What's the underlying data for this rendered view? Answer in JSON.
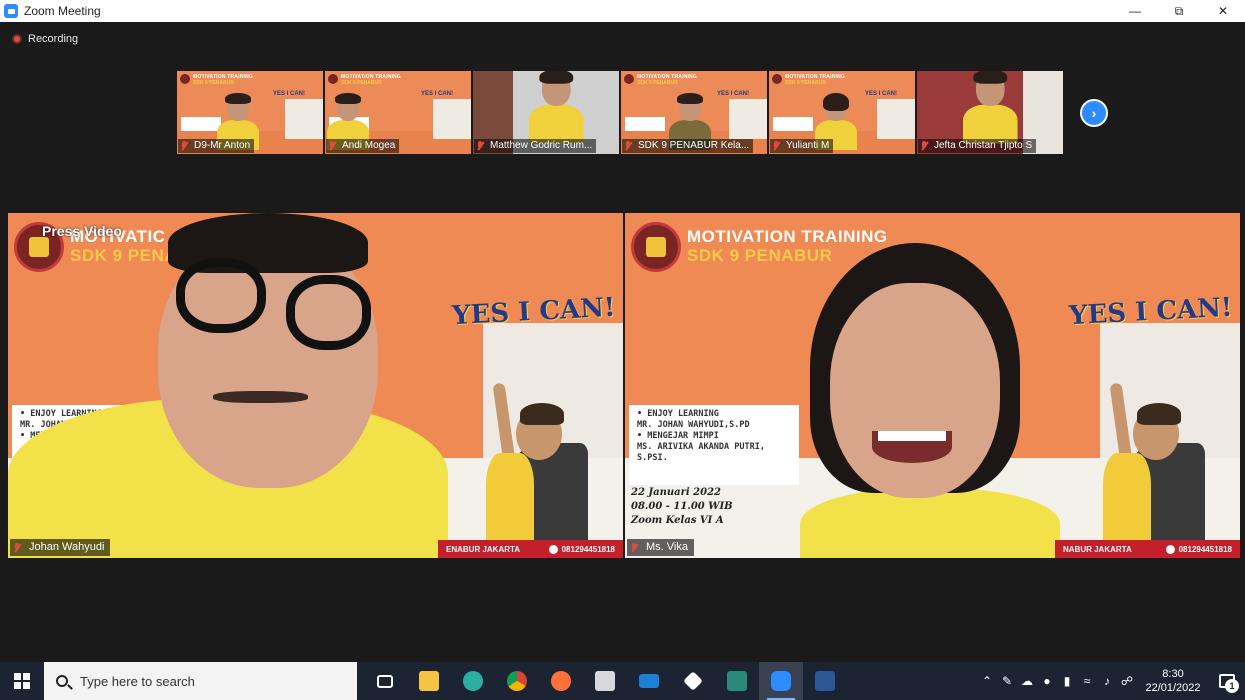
{
  "window": {
    "title": "Zoom Meeting",
    "minimize_icon": "minimize-icon",
    "restore_icon": "restore-icon",
    "close_icon": "close-icon"
  },
  "recording": {
    "label": "Recording"
  },
  "thumbnails": [
    {
      "name": "D9-Mr Anton",
      "ttitle": "MOTIVATION TRAINING",
      "tsub": "SDK 9 PENABUR",
      "yes": "YES I CAN!"
    },
    {
      "name": "Andi Mogea",
      "ttitle": "MOTIVATION TRAINING",
      "tsub": "SDK 9 PENABUR",
      "yes": "YES I CAN!"
    },
    {
      "name": "Matthew Godric Rum...",
      "ttitle": "",
      "tsub": "",
      "yes": ""
    },
    {
      "name": "SDK 9 PENABUR Kela...",
      "ttitle": "MOTIVATION TRAINING",
      "tsub": "SDK 9 PENABUR",
      "yes": "YES I CAN!"
    },
    {
      "name": "Yulianti M",
      "ttitle": "MOTIVATION TRAINING",
      "tsub": "SDK 9 PENABUR",
      "yes": "YES I CAN!"
    },
    {
      "name": "Jefta Christan Tjipto S",
      "ttitle": "",
      "tsub": "",
      "yes": ""
    }
  ],
  "tiles": {
    "left": {
      "name": "Johan Wahyudi",
      "overlay": "Press Video",
      "title": "MOTIVATIC",
      "subtitle": "SDK 9 PENA",
      "yes": "YES I CAN!",
      "agenda": [
        "• ENJOY LEARNING",
        "  MR. JOHAN WA...",
        "• MENG..."
      ],
      "footer_left": "ENABUR JAKARTA",
      "footer_phone": "081294451818"
    },
    "right": {
      "name": "Ms. Vika",
      "title": "MOTIVATION TRAINING",
      "subtitle": "SDK 9 PENABUR",
      "yes": "YES I CAN!",
      "agenda": [
        "• ENJOY LEARNING",
        "  MR. JOHAN WAHYUDI,S.PD",
        "• MENGEJAR MIMPI",
        "  MS. ARIVIKA AKANDA PUTRI, S.PSI."
      ],
      "info": [
        "22 Januari 2022",
        "08.00 - 11.00 WIB",
        "Zoom Kelas VI A"
      ],
      "footer_left": "NABUR JAKARTA",
      "footer_phone": "081294451818"
    }
  },
  "taskbar": {
    "search_placeholder": "Type here to search",
    "time": "8:30",
    "date": "22/01/2022",
    "notifications": "1"
  },
  "colors": {
    "zoom_blue": "#2d8cff",
    "muted_red": "#e04a3f",
    "slide_orange": "#ef8a55",
    "taskbar": "#1c2333"
  }
}
